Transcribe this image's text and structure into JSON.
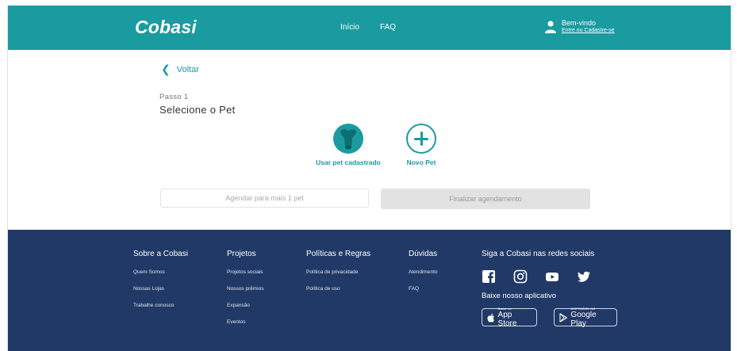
{
  "header": {
    "logo": "Cobasi",
    "nav": [
      "Início",
      "FAQ"
    ],
    "welcome": "Bem-vindo",
    "login_link": "Entre ou Cadastre-se"
  },
  "main": {
    "back_label": "Voltar",
    "step_label": "Passo 1",
    "step_title": "Selecione o Pet",
    "options": [
      "Usar pet cadastrado",
      "Novo Pet"
    ],
    "add_pet_button": "Agendar para mais 1 pet",
    "finish_button": "Finalizar agendamento"
  },
  "footer": {
    "about": {
      "title": "Sobre a Cobasi",
      "links": [
        "Quem Somos",
        "Nossas Lojas",
        "Trabalhe conosco"
      ]
    },
    "projects": {
      "title": "Projetos",
      "links": [
        "Projetos sociais",
        "Nossos prêmios",
        "Expansão",
        "Eventos"
      ]
    },
    "policies": {
      "title": "Políticas e Regras",
      "links": [
        "Política de privacidade",
        "Política de uso"
      ]
    },
    "help": {
      "title": "Dúvidas",
      "links": [
        "Atendimento",
        "FAQ"
      ]
    },
    "social_title": "Siga a Cobasi nas redes sociais",
    "social_icons": [
      "facebook-icon",
      "instagram-icon",
      "youtube-icon",
      "twitter-icon"
    ],
    "app_title": "Baixe nosso aplicativo",
    "app_store": {
      "small": "Baixar na",
      "big": "App Store"
    },
    "google_play": {
      "small": "DISPONÍVEL NO",
      "big": "Google Play"
    }
  },
  "colors": {
    "brand": "#1a9ba0",
    "footer": "#213966",
    "disabled": "#e2e2e2"
  }
}
